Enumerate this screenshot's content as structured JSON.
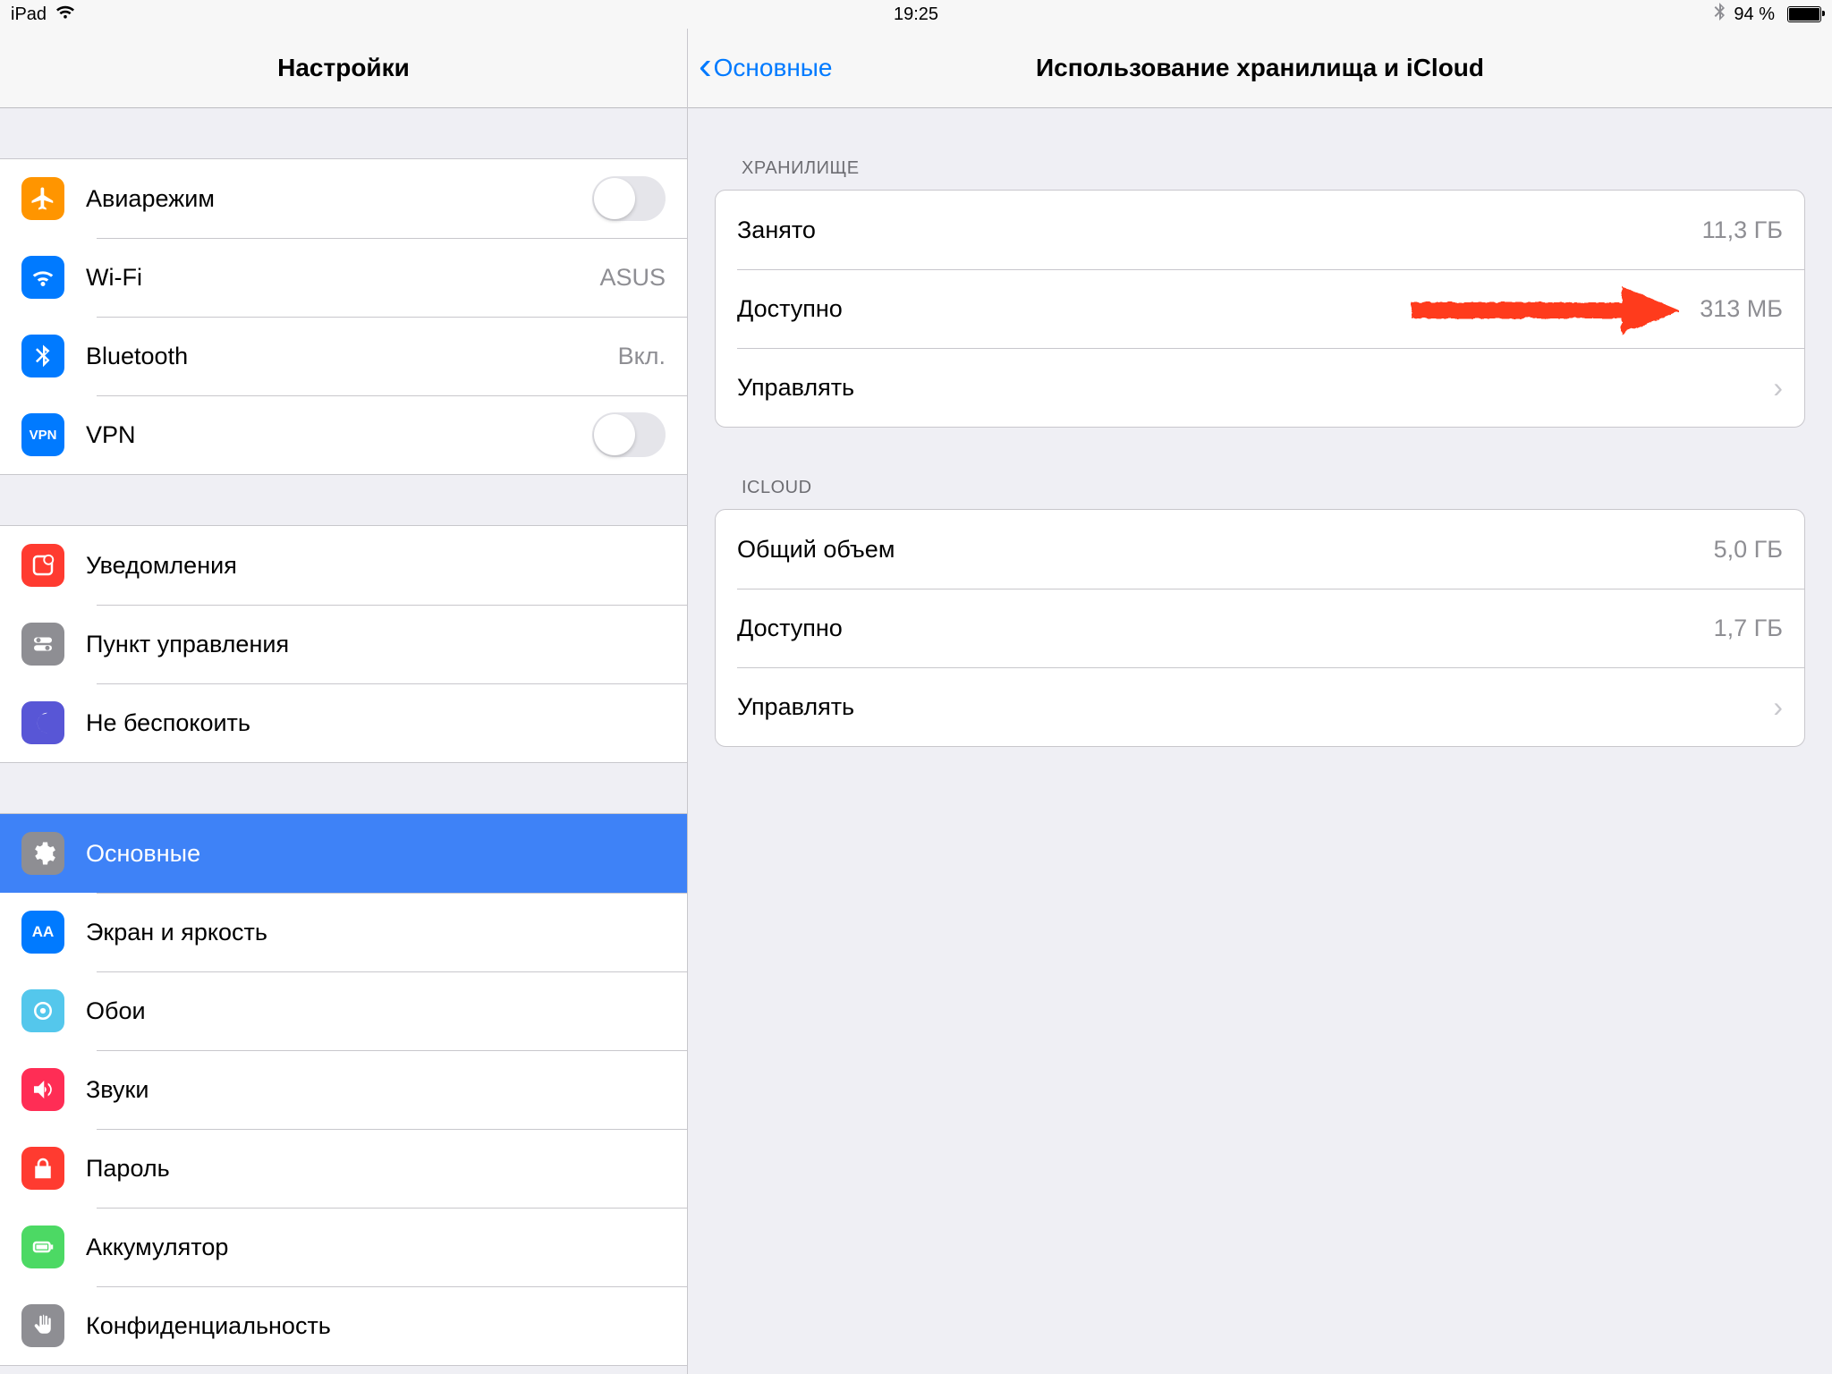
{
  "statusbar": {
    "device": "iPad",
    "time": "19:25",
    "battery": "94 %"
  },
  "sidebar": {
    "title": "Настройки",
    "groups": [
      {
        "items": [
          {
            "id": "airplane",
            "label": "Авиарежим",
            "control": "switch",
            "iconColor": "#FF9500"
          },
          {
            "id": "wifi",
            "label": "Wi-Fi",
            "value": "ASUS",
            "iconColor": "#007AFF"
          },
          {
            "id": "bluetooth",
            "label": "Bluetooth",
            "value": "Вкл.",
            "iconColor": "#007AFF"
          },
          {
            "id": "vpn",
            "label": "VPN",
            "control": "switch",
            "iconColor": "#007AFF",
            "iconText": "VPN"
          }
        ]
      },
      {
        "items": [
          {
            "id": "notifications",
            "label": "Уведомления",
            "iconColor": "#FF3B30"
          },
          {
            "id": "controlcenter",
            "label": "Пункт управления",
            "iconColor": "#8E8E93"
          },
          {
            "id": "dnd",
            "label": "Не беспокоить",
            "iconColor": "#5856D6"
          }
        ]
      },
      {
        "items": [
          {
            "id": "general",
            "label": "Основные",
            "iconColor": "#8E8E93",
            "selected": true
          },
          {
            "id": "display",
            "label": "Экран и яркость",
            "iconColor": "#007AFF",
            "iconText": "AA"
          },
          {
            "id": "wallpaper",
            "label": "Обои",
            "iconColor": "#54C7EC"
          },
          {
            "id": "sounds",
            "label": "Звуки",
            "iconColor": "#FF2D55"
          },
          {
            "id": "passcode",
            "label": "Пароль",
            "iconColor": "#FF3B30"
          },
          {
            "id": "battery",
            "label": "Аккумулятор",
            "iconColor": "#4CD964"
          },
          {
            "id": "privacy",
            "label": "Конфиденциальность",
            "iconColor": "#8E8E93"
          }
        ]
      }
    ]
  },
  "detail": {
    "back": "Основные",
    "title": "Использование хранилища и iCloud",
    "groups": [
      {
        "header": "ХРАНИЛИЩЕ",
        "items": [
          {
            "id": "storage-used",
            "label": "Занято",
            "value": "11,3 ГБ"
          },
          {
            "id": "storage-avail",
            "label": "Доступно",
            "value": "313 МБ",
            "annotated": true
          },
          {
            "id": "storage-manage",
            "label": "Управлять",
            "disclosure": true
          }
        ]
      },
      {
        "header": "ICLOUD",
        "items": [
          {
            "id": "icloud-total",
            "label": "Общий объем",
            "value": "5,0 ГБ"
          },
          {
            "id": "icloud-avail",
            "label": "Доступно",
            "value": "1,7 ГБ"
          },
          {
            "id": "icloud-manage",
            "label": "Управлять",
            "disclosure": true
          }
        ]
      }
    ]
  },
  "colors": {
    "accent": "#007AFF",
    "annotation": "#FF3A1F"
  }
}
